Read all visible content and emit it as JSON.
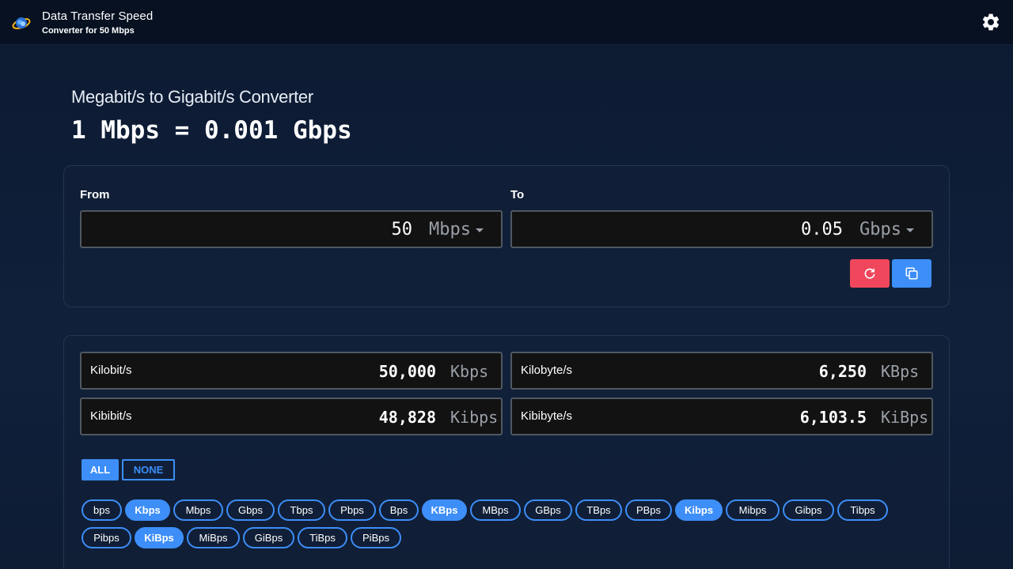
{
  "header": {
    "title": "Data Transfer Speed",
    "subtitle": "Converter for 50 Mbps",
    "logo_icon": "globe-cloud-icon",
    "settings_icon": "gear-icon"
  },
  "page": {
    "heading": "Megabit/s to Gigabit/s Converter",
    "formula": "1 Mbps = 0.001 Gbps"
  },
  "converter": {
    "from_label": "From",
    "to_label": "To",
    "from_value": "50",
    "from_unit": "Mbps",
    "to_value": "0.05",
    "to_unit": "Gbps",
    "reset_icon": "refresh-icon",
    "copy_icon": "copy-icon"
  },
  "results": [
    {
      "name": "Kilobit/s",
      "value": "50,000",
      "unit": "Kbps"
    },
    {
      "name": "Kilobyte/s",
      "value": "6,250",
      "unit": "KBps"
    },
    {
      "name": "Kibibit/s",
      "value": "48,828",
      "unit": "Kibps"
    },
    {
      "name": "Kibibyte/s",
      "value": "6,103.5",
      "unit": "KiBps"
    }
  ],
  "filters": {
    "all_label": "ALL",
    "none_label": "NONE"
  },
  "units": [
    {
      "label": "bps",
      "selected": false
    },
    {
      "label": "Kbps",
      "selected": true
    },
    {
      "label": "Mbps",
      "selected": false
    },
    {
      "label": "Gbps",
      "selected": false
    },
    {
      "label": "Tbps",
      "selected": false
    },
    {
      "label": "Pbps",
      "selected": false
    },
    {
      "label": "Bps",
      "selected": false
    },
    {
      "label": "KBps",
      "selected": true
    },
    {
      "label": "MBps",
      "selected": false
    },
    {
      "label": "GBps",
      "selected": false
    },
    {
      "label": "TBps",
      "selected": false
    },
    {
      "label": "PBps",
      "selected": false
    },
    {
      "label": "Kibps",
      "selected": true
    },
    {
      "label": "Mibps",
      "selected": false
    },
    {
      "label": "Gibps",
      "selected": false
    },
    {
      "label": "Tibps",
      "selected": false
    },
    {
      "label": "Pibps",
      "selected": false
    },
    {
      "label": "KiBps",
      "selected": true
    },
    {
      "label": "MiBps",
      "selected": false
    },
    {
      "label": "GiBps",
      "selected": false
    },
    {
      "label": "TiBps",
      "selected": false
    },
    {
      "label": "PiBps",
      "selected": false
    }
  ],
  "colors": {
    "accent": "#3d8ef8",
    "danger": "#f0475d",
    "background": "#0f1d35"
  }
}
